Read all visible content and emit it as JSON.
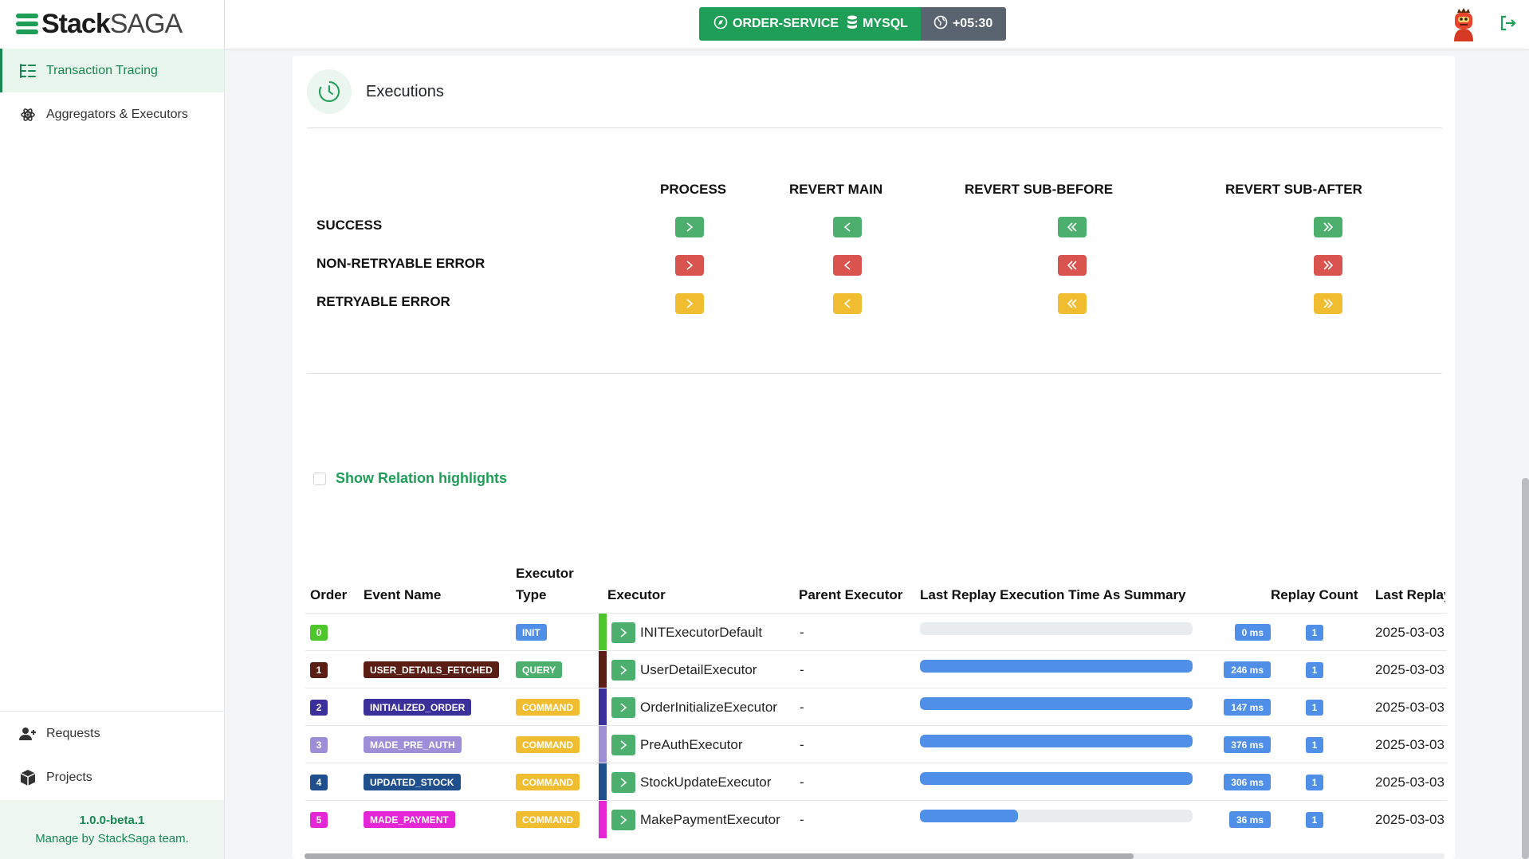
{
  "brand": {
    "bold": "Stack",
    "light": "SAGA"
  },
  "sidebar": {
    "items": [
      {
        "label": "Transaction Tracing",
        "icon": "tree-list-icon",
        "active": true
      },
      {
        "label": "Aggregators & Executors",
        "icon": "atom-icon",
        "active": false
      }
    ],
    "bottom_items": [
      {
        "label": "Requests",
        "icon": "user-plus-icon"
      },
      {
        "label": "Projects",
        "icon": "box-icon"
      }
    ],
    "footer": {
      "version": "1.0.0-beta.1",
      "credit": "Manage by StackSaga team."
    }
  },
  "topbar": {
    "service": "ORDER-SERVICE",
    "database": "MYSQL",
    "timezone": "+05:30"
  },
  "card": {
    "title": "Executions",
    "legend": {
      "columns": [
        "PROCESS",
        "REVERT MAIN",
        "REVERT SUB-BEFORE",
        "REVERT SUB-AFTER"
      ],
      "rows": [
        "SUCCESS",
        "NON-RETRYABLE ERROR",
        "RETRYABLE ERROR"
      ],
      "row_colors": [
        "#4caf6d",
        "#d9534f",
        "#f0bd30"
      ]
    },
    "relation_label": "Show Relation highlights"
  },
  "table": {
    "headers": {
      "order": "Order",
      "event_name": "Event Name",
      "executor_type_1": "Executor",
      "executor_type_2": "Type",
      "executor": "Executor",
      "parent_executor": "Parent Executor",
      "time_summary": "Last Replay Execution Time As Summary",
      "replay_count": "Replay Count",
      "last_replay": "Last Replay"
    },
    "rows": [
      {
        "order": "0",
        "order_color": "#4cc62a",
        "event": "",
        "event_color": "",
        "type": "INIT",
        "type_color": "#4f8fe8",
        "strip": "#4cc62a",
        "executor": "INITExecutorDefault",
        "parent": "-",
        "ms": "0 ms",
        "time_fraction": 0,
        "replay": "1",
        "last": "2025-03-03"
      },
      {
        "order": "1",
        "order_color": "#5a1e14",
        "event": "USER_DETAILS_FETCHED",
        "event_color": "#5a1e14",
        "type": "QUERY",
        "type_color": "#4caf6d",
        "strip": "#5a1e14",
        "executor": "UserDetailExecutor",
        "parent": "-",
        "ms": "246 ms",
        "time_fraction": 1,
        "replay": "1",
        "last": "2025-03-03"
      },
      {
        "order": "2",
        "order_color": "#3b2f9c",
        "event": "INITIALIZED_ORDER",
        "event_color": "#3b2f9c",
        "type": "COMMAND",
        "type_color": "#f0bd30",
        "strip": "#3b2f9c",
        "executor": "OrderInitializeExecutor",
        "parent": "-",
        "ms": "147 ms",
        "time_fraction": 1,
        "replay": "1",
        "last": "2025-03-03"
      },
      {
        "order": "3",
        "order_color": "#9c8fd8",
        "event": "MADE_PRE_AUTH",
        "event_color": "#9c8fd8",
        "type": "COMMAND",
        "type_color": "#f0bd30",
        "strip": "#9c8fd8",
        "executor": "PreAuthExecutor",
        "parent": "-",
        "ms": "376 ms",
        "time_fraction": 1,
        "replay": "1",
        "last": "2025-03-03"
      },
      {
        "order": "4",
        "order_color": "#1f4f8c",
        "event": "UPDATED_STOCK",
        "event_color": "#1f4f8c",
        "type": "COMMAND",
        "type_color": "#f0bd30",
        "strip": "#1f4f8c",
        "executor": "StockUpdateExecutor",
        "parent": "-",
        "ms": "306 ms",
        "time_fraction": 1,
        "replay": "1",
        "last": "2025-03-03"
      },
      {
        "order": "5",
        "order_color": "#e526d6",
        "event": "MADE_PAYMENT",
        "event_color": "#e526d6",
        "type": "COMMAND",
        "type_color": "#f0bd30",
        "strip": "#e526d6",
        "executor": "MakePaymentExecutor",
        "parent": "-",
        "ms": "36 ms",
        "time_fraction": 0.36,
        "replay": "1",
        "last": "2025-03-03"
      }
    ]
  }
}
